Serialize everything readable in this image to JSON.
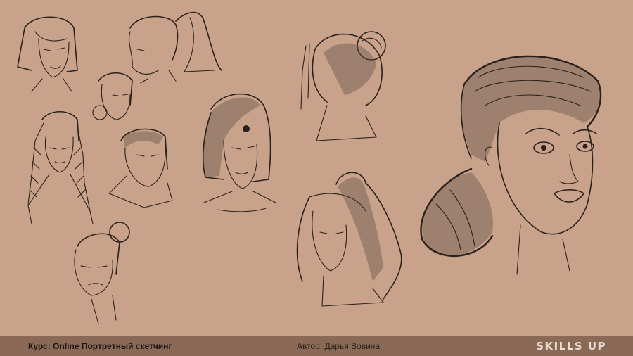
{
  "footer": {
    "course": "Курс: Online Портретный скетчинг",
    "author": "Автор: Дарья Вовина",
    "logo": "SKILLS UP"
  },
  "colors": {
    "background": "#c8a28a",
    "footer_bar": "#8a6a57",
    "ink": "#2b211c",
    "logo_text": "#e9dcd2"
  }
}
